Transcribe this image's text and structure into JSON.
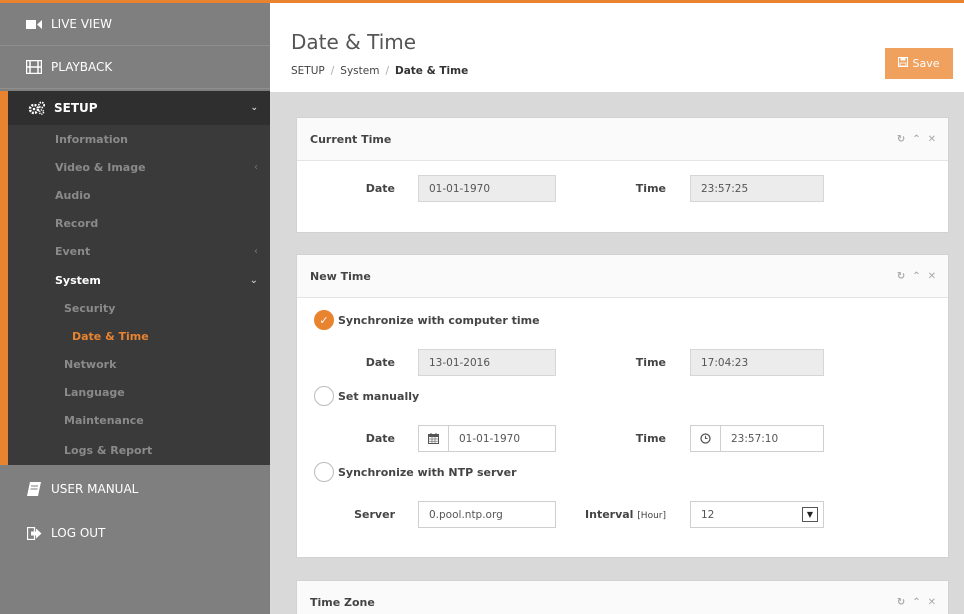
{
  "sidebar": {
    "live_view": "LIVE VIEW",
    "playback": "PLAYBACK",
    "setup": "SETUP",
    "sub": {
      "information": "Information",
      "video_image": "Video & Image",
      "audio": "Audio",
      "record": "Record",
      "event": "Event",
      "system": "System",
      "security": "Security",
      "date_time": "Date & Time",
      "network": "Network",
      "language": "Language",
      "maintenance": "Maintenance",
      "logs_report": "Logs & Report"
    },
    "user_manual": "USER MANUAL",
    "log_out": "LOG OUT"
  },
  "header": {
    "title": "Date & Time",
    "breadcrumb": [
      "SETUP",
      "System",
      "Date & Time"
    ],
    "save_label": "Save"
  },
  "current_time": {
    "title": "Current Time",
    "date_label": "Date",
    "date_value": "01-01-1970",
    "time_label": "Time",
    "time_value": "23:57:25"
  },
  "new_time": {
    "title": "New Time",
    "sync_computer": {
      "label": "Synchronize with computer time",
      "selected": true,
      "date_label": "Date",
      "date_value": "13-01-2016",
      "time_label": "Time",
      "time_value": "17:04:23"
    },
    "manual": {
      "label": "Set manually",
      "selected": false,
      "date_label": "Date",
      "date_value": "01-01-1970",
      "time_label": "Time",
      "time_value": "23:57:10"
    },
    "ntp": {
      "label": "Synchronize with NTP server",
      "selected": false,
      "server_label": "Server",
      "server_value": "0.pool.ntp.org",
      "interval_label": "Interval",
      "interval_unit": "[Hour]",
      "interval_value": "12"
    }
  },
  "time_zone": {
    "title": "Time Zone"
  },
  "colors": {
    "accent": "#e8832f",
    "sidebar_bg": "#7f7f7f",
    "submenu_bg": "#3a3a3a"
  }
}
